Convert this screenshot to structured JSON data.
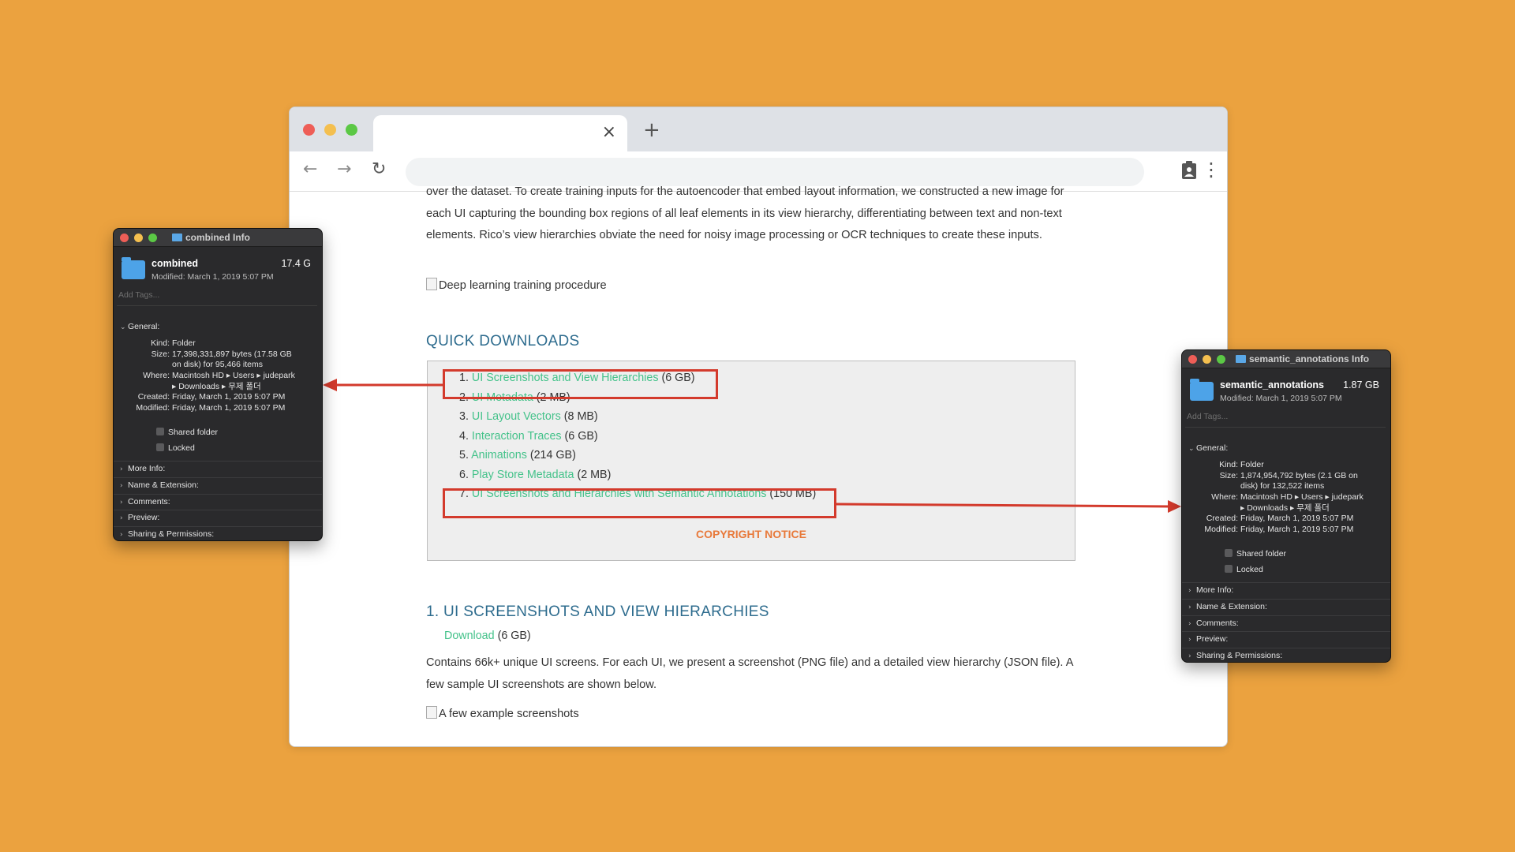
{
  "browser": {
    "tab_close": "×",
    "new_tab": "+",
    "back": "←",
    "forward": "→",
    "reload": "↻",
    "menu": "⋮"
  },
  "page": {
    "intro_text": "over the dataset. To create training inputs for the autoencoder that embed layout information, we constructed a new image for each UI capturing the bounding box regions of all leaf elements in its view hierarchy, differentiating between text and non-text elements. Rico’s view hierarchies obviate the need for noisy image processing or OCR techniques to create these inputs.",
    "image1_alt": "Deep learning training procedure",
    "quick_downloads_heading": "QUICK DOWNLOADS",
    "downloads": [
      {
        "num": "1.",
        "label": "UI Screenshots and View Hierarchies",
        "size": "(6 GB)"
      },
      {
        "num": "2.",
        "label": "UI Metadata",
        "size": "(2 MB)"
      },
      {
        "num": "3.",
        "label": "UI Layout Vectors",
        "size": "(8 MB)"
      },
      {
        "num": "4.",
        "label": "Interaction Traces",
        "size": "(6 GB)"
      },
      {
        "num": "5.",
        "label": "Animations",
        "size": "(214 GB)"
      },
      {
        "num": "6.",
        "label": "Play Store Metadata",
        "size": "(2 MB)"
      },
      {
        "num": "7.",
        "label": "UI Screenshots and Hierarchies with Semantic Annotations",
        "size": "(150 MB)"
      }
    ],
    "copyright": "COPYRIGHT NOTICE",
    "section1_heading": "1. UI SCREENSHOTS AND VIEW HIERARCHIES",
    "section1_download_link": "Download",
    "section1_download_size": "(6 GB)",
    "section1_text": "Contains 66k+ unique UI screens. For each UI, we present a screenshot (PNG file) and a detailed view hierarchy (JSON file). A few sample UI screenshots are shown below.",
    "image2_alt": "A few example screenshots"
  },
  "info_left": {
    "window_title": "combined Info",
    "name": "combined",
    "size": "17.4 G",
    "modified_line": "Modified: March 1, 2019 5:07 PM",
    "tags_placeholder": "Add Tags...",
    "general_label": "General:",
    "kind_k": "Kind:",
    "kind_v": "Folder",
    "size_k": "Size:",
    "size_v1": "17,398,331,897 bytes (17.58 GB",
    "size_v2": "on disk) for 95,466 items",
    "where_k": "Where:",
    "where_v1": "Macintosh HD ▸ Users ▸ judepark",
    "where_v2": "▸ Downloads ▸ 무제 폴더",
    "created_k": "Created:",
    "created_v": "Friday, March 1, 2019 5:07 PM",
    "modified_k": "Modified:",
    "modified_v": "Friday, March 1, 2019 5:07 PM",
    "shared_folder": "Shared folder",
    "locked": "Locked",
    "sections": [
      "More Info:",
      "Name & Extension:",
      "Comments:",
      "Preview:",
      "Sharing & Permissions:"
    ]
  },
  "info_right": {
    "window_title": "semantic_annotations Info",
    "name": "semantic_annotations",
    "size": "1.87 GB",
    "modified_line": "Modified: March 1, 2019 5:07 PM",
    "tags_placeholder": "Add Tags...",
    "general_label": "General:",
    "kind_k": "Kind:",
    "kind_v": "Folder",
    "size_k": "Size:",
    "size_v1": "1,874,954,792 bytes (2.1 GB on",
    "size_v2": "disk) for 132,522 items",
    "where_k": "Where:",
    "where_v1": "Macintosh HD ▸ Users ▸ judepark",
    "where_v2": "▸ Downloads ▸ 무제 폴더",
    "created_k": "Created:",
    "created_v": "Friday, March 1, 2019 5:07 PM",
    "modified_k": "Modified:",
    "modified_v": "Friday, March 1, 2019 5:07 PM",
    "shared_folder": "Shared folder",
    "locked": "Locked",
    "sections": [
      "More Info:",
      "Name & Extension:",
      "Comments:",
      "Preview:",
      "Sharing & Permissions:"
    ]
  },
  "colors": {
    "background": "#EBA23F",
    "link": "#44C28A",
    "heading": "#2E6C8E",
    "copyright": "#E8793A",
    "highlight": "#D33A2C"
  }
}
